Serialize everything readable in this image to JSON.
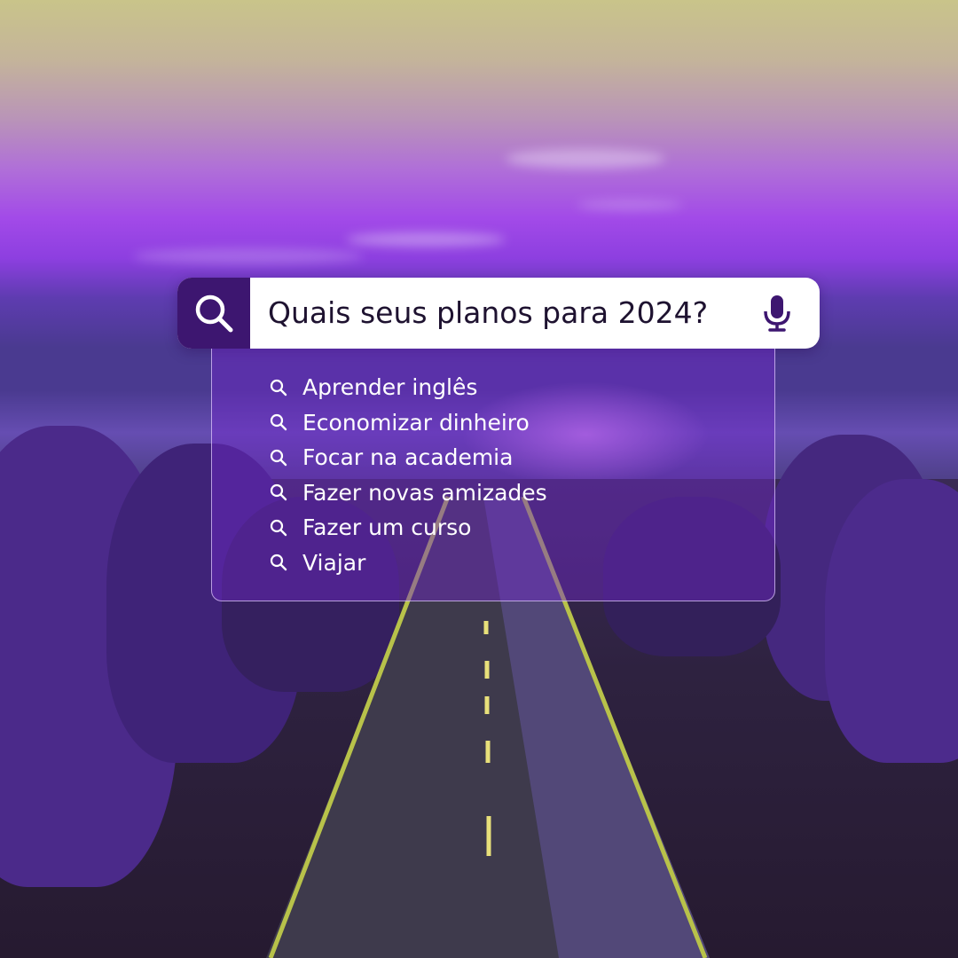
{
  "search": {
    "query": "Quais seus planos para 2024?",
    "icon": "search-icon",
    "mic_icon": "microphone-icon"
  },
  "suggestions": [
    {
      "label": "Aprender inglês"
    },
    {
      "label": "Economizar dinheiro"
    },
    {
      "label": "Focar na academia"
    },
    {
      "label": "Fazer novas amizades"
    },
    {
      "label": "Fazer um curso"
    },
    {
      "label": "Viajar"
    }
  ],
  "colors": {
    "accent": "#3d1670",
    "dropdown_tint": "#6e28c8",
    "sky_top": "#c9c48a",
    "sky_purple": "#a24ae8"
  }
}
